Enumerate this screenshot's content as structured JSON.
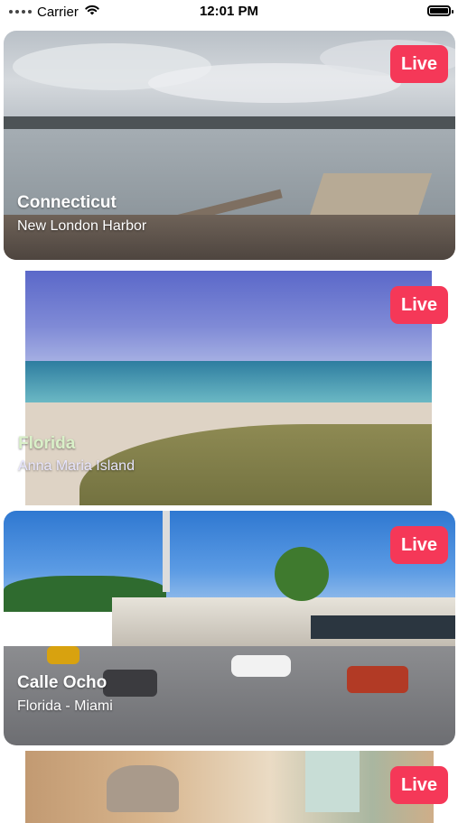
{
  "status_bar": {
    "carrier": "Carrier",
    "time": "12:01 PM",
    "signal_icon": "signal-dots-icon",
    "wifi_icon": "wifi-icon",
    "battery_icon": "battery-icon"
  },
  "colors": {
    "live_badge": "#f53858",
    "card_text": "#ffffff"
  },
  "cameras": [
    {
      "title": "Connecticut",
      "subtitle": "New London Harbor",
      "badge": "Live"
    },
    {
      "title": "Florida",
      "subtitle": "Anna Maria Island",
      "badge": "Live"
    },
    {
      "title": "Calle Ocho",
      "subtitle": "Florida - Miami",
      "badge": "Live"
    },
    {
      "title": "",
      "subtitle": "",
      "badge": "Live"
    }
  ]
}
